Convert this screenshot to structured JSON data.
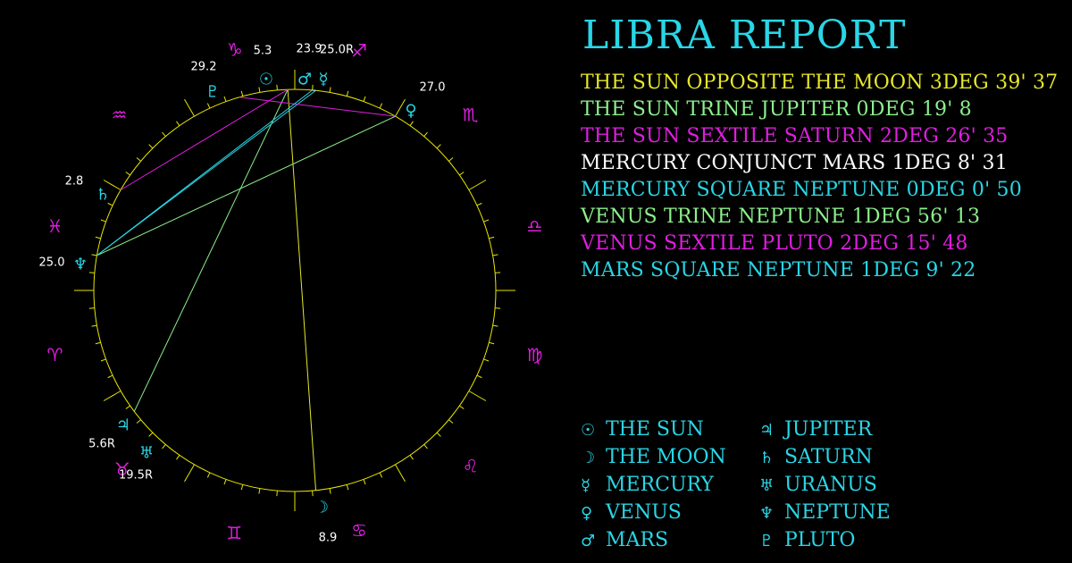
{
  "report_title": "LIBRA REPORT",
  "colors": {
    "title": "#29d6e6",
    "signs": "#e01ee0",
    "planets": "#29d6e6",
    "circle": "#e6e600",
    "degree_labels": "#ffffff"
  },
  "aspects": [
    {
      "text": "THE SUN OPPOSITE THE MOON 3DEG 39' 37",
      "color": "#e6e62a"
    },
    {
      "text": "THE SUN TRINE JUPITER 0DEG 19' 8",
      "color": "#8cf08c"
    },
    {
      "text": "THE SUN SEXTILE SATURN 2DEG 26' 35",
      "color": "#e01ee0"
    },
    {
      "text": "MERCURY CONJUNCT MARS 1DEG 8' 31",
      "color": "#ffffff"
    },
    {
      "text": "MERCURY SQUARE NEPTUNE 0DEG 0' 50",
      "color": "#29d6e6"
    },
    {
      "text": "VENUS TRINE NEPTUNE 1DEG 56' 13",
      "color": "#8cf08c"
    },
    {
      "text": "VENUS SEXTILE PLUTO 2DEG 15' 48",
      "color": "#e01ee0"
    },
    {
      "text": "MARS SQUARE NEPTUNE 1DEG 9' 22",
      "color": "#29d6e6"
    }
  ],
  "legend": [
    {
      "glyph": "☉",
      "label": "THE SUN",
      "icon": "sun-icon"
    },
    {
      "glyph": "♃",
      "label": "JUPITER",
      "icon": "jupiter-icon"
    },
    {
      "glyph": "☽",
      "label": "THE MOON",
      "icon": "moon-icon"
    },
    {
      "glyph": "♄",
      "label": "SATURN",
      "icon": "saturn-icon"
    },
    {
      "glyph": "☿",
      "label": "MERCURY",
      "icon": "mercury-icon"
    },
    {
      "glyph": "♅",
      "label": "URANUS",
      "icon": "uranus-icon"
    },
    {
      "glyph": "♀",
      "label": "VENUS",
      "icon": "venus-icon"
    },
    {
      "glyph": "♆",
      "label": "NEPTUNE",
      "icon": "neptune-icon"
    },
    {
      "glyph": "♂",
      "label": "MARS",
      "icon": "mars-icon"
    },
    {
      "glyph": "♇",
      "label": "PLUTO",
      "icon": "pluto-icon"
    }
  ],
  "zodiac_signs": [
    {
      "glyph": "♑",
      "name": "capricorn"
    },
    {
      "glyph": "♐",
      "name": "sagittarius"
    },
    {
      "glyph": "♏",
      "name": "scorpio"
    },
    {
      "glyph": "♎",
      "name": "libra"
    },
    {
      "glyph": "♍",
      "name": "virgo"
    },
    {
      "glyph": "♌",
      "name": "leo"
    },
    {
      "glyph": "♋",
      "name": "cancer"
    },
    {
      "glyph": "♊",
      "name": "gemini"
    },
    {
      "glyph": "♉",
      "name": "taurus"
    },
    {
      "glyph": "♈",
      "name": "aries"
    },
    {
      "glyph": "♓",
      "name": "pisces"
    },
    {
      "glyph": "♒",
      "name": "aquarius"
    }
  ],
  "planets": [
    {
      "name": "sun",
      "glyph": "☉",
      "degree": "5.3"
    },
    {
      "name": "mars",
      "glyph": "♂",
      "degree": "23.9"
    },
    {
      "name": "mercury",
      "glyph": "☿",
      "degree": "25.0R"
    },
    {
      "name": "pluto",
      "glyph": "♇",
      "degree": "29.2"
    },
    {
      "name": "venus",
      "glyph": "♀",
      "degree": "27.0"
    },
    {
      "name": "saturn",
      "glyph": "♄",
      "degree": "2.8"
    },
    {
      "name": "neptune",
      "glyph": "♆",
      "degree": "25.0"
    },
    {
      "name": "jupiter",
      "glyph": "♃",
      "degree": "5.6R"
    },
    {
      "name": "uranus",
      "glyph": "♅",
      "degree": "19.5R"
    },
    {
      "name": "moon",
      "glyph": "☽",
      "degree": "8.9"
    }
  ],
  "aspect_lines": [
    {
      "from": "sun",
      "to": "moon",
      "color": "#e6e62a"
    },
    {
      "from": "sun",
      "to": "jupiter",
      "color": "#8cf08c"
    },
    {
      "from": "sun",
      "to": "saturn",
      "color": "#e01ee0"
    },
    {
      "from": "mercury",
      "to": "mars",
      "color": "#ffffff"
    },
    {
      "from": "mercury",
      "to": "neptune",
      "color": "#29d6e6"
    },
    {
      "from": "venus",
      "to": "neptune",
      "color": "#8cf08c"
    },
    {
      "from": "venus",
      "to": "pluto",
      "color": "#e01ee0"
    },
    {
      "from": "mars",
      "to": "neptune",
      "color": "#29d6e6"
    }
  ]
}
